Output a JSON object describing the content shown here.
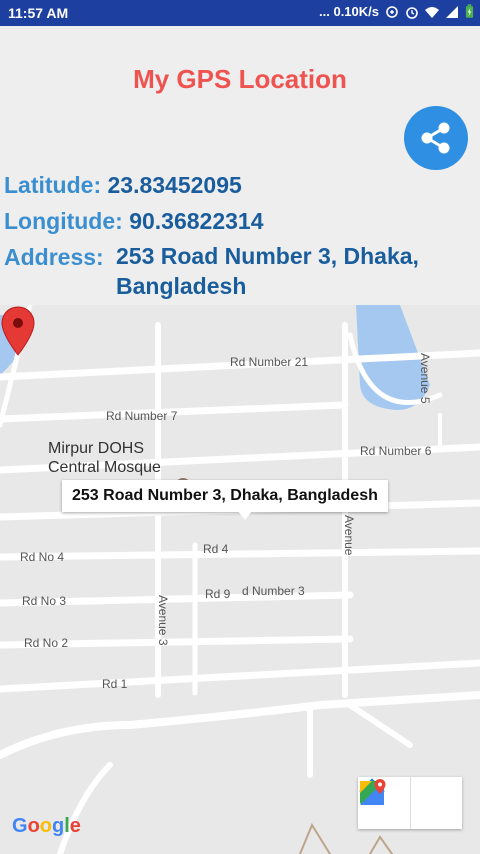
{
  "status_bar": {
    "time": "11:57 AM",
    "network_speed": "... 0.10K/s",
    "icons": [
      "data-saver-icon",
      "alarm-icon",
      "wifi-icon",
      "signal-icon",
      "battery-charging-icon"
    ]
  },
  "header": {
    "title": "My GPS Location",
    "share_icon": "share-icon"
  },
  "location": {
    "latitude_label": "Latitude:",
    "latitude_value": "23.83452095",
    "longitude_label": "Longitude:",
    "longitude_value": "90.36822314",
    "address_label": "Address:",
    "address_value": "253 Road Number 3, Dhaka, Bangladesh"
  },
  "map": {
    "info_window": "253 Road Number 3, Dhaka, Bangladesh",
    "poi_name": "Mirpur DOHS Central Mosque",
    "roads": {
      "rd21": "Rd Number 21",
      "rd7": "Rd Number 7",
      "rd6": "Rd Number 6",
      "av5": "Avenue 5",
      "rd4": "Rd 4",
      "rdno4": "Rd No 4",
      "rdno3": "Rd No 3",
      "rd9": "Rd 9",
      "rdnum3": "d Number 3",
      "av3": "Avenue 3",
      "av": "Avenue",
      "rdno2": "Rd No 2",
      "rd1": "Rd 1"
    },
    "google_logo": "Google",
    "buttons": {
      "directions_icon": "directions-icon",
      "open_maps_icon": "google-maps-icon"
    },
    "colors": {
      "water": "#a4c8f0",
      "road": "#ffffff",
      "pin": "#e53935"
    }
  }
}
